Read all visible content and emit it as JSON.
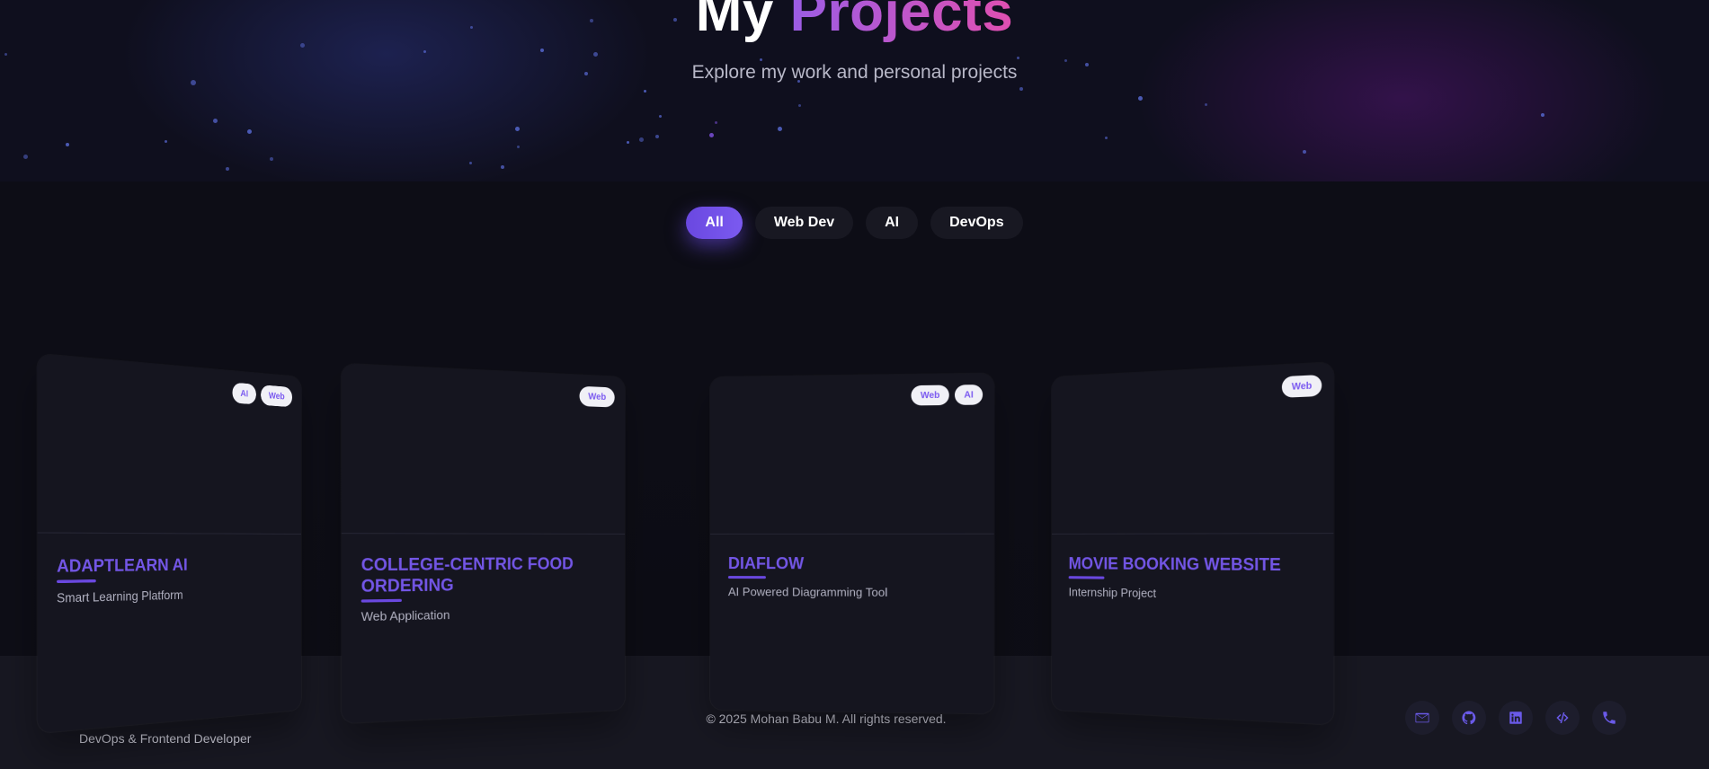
{
  "hero": {
    "title_white": "My",
    "title_gradient": "Projects",
    "subtitle": "Explore my work and personal projects"
  },
  "filters": [
    {
      "label": "All",
      "active": true
    },
    {
      "label": "Web Dev",
      "active": false
    },
    {
      "label": "AI",
      "active": false
    },
    {
      "label": "DevOps",
      "active": false
    }
  ],
  "projects": [
    {
      "title": "AdaptLearn AI",
      "subtitle": "Smart Learning Platform",
      "tags": [
        "AI",
        "Web"
      ]
    },
    {
      "title": "College-Centric Food Ordering",
      "subtitle": "Web Application",
      "tags": [
        "Web"
      ]
    },
    {
      "title": "DiaFlow",
      "subtitle": "AI Powered Diagramming Tool",
      "tags": [
        "Web",
        "AI"
      ]
    },
    {
      "title": "Movie Booking Website",
      "subtitle": "Internship Project",
      "tags": [
        "Web"
      ]
    }
  ],
  "footer": {
    "role": "DevOps & Frontend Developer",
    "copyright": "© 2025 Mohan Babu M. All rights reserved.",
    "socials": [
      "mail-icon",
      "github-icon",
      "linkedin-icon",
      "code-icon",
      "phone-icon"
    ]
  },
  "colors": {
    "accent": "#6a48e0",
    "title_gradient_start": "#9b5de5",
    "title_gradient_end": "#e04fb0",
    "background": "#0d0d16",
    "card": "#15151f"
  }
}
